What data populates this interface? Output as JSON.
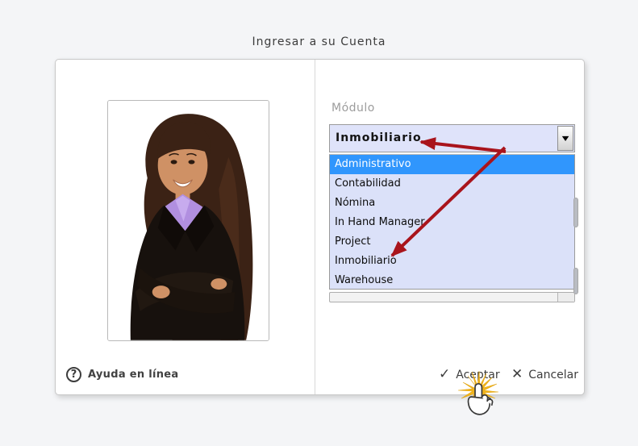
{
  "window": {
    "title": "Ingresar a su Cuenta"
  },
  "left": {
    "help_label": "Ayuda en línea"
  },
  "module": {
    "label": "Módulo",
    "selected_value": "Inmobiliario",
    "highlighted_index": 0,
    "options": [
      "Administrativo",
      "Contabilidad",
      "Nómina",
      "In Hand Manager",
      "Project",
      "Inmobiliario",
      "Warehouse"
    ]
  },
  "footer": {
    "accept_label": "Aceptar",
    "cancel_label": "Cancelar"
  },
  "icons": {
    "help": "?",
    "dropdown": "▼",
    "accept": "✓",
    "cancel": "✕"
  },
  "colors": {
    "selection_blue": "#3096fd",
    "combo_bg": "#dfe3fa",
    "list_bg": "#dbe1f9",
    "arrow_red": "#a9141c",
    "star_yellow": "#f2b51d"
  }
}
